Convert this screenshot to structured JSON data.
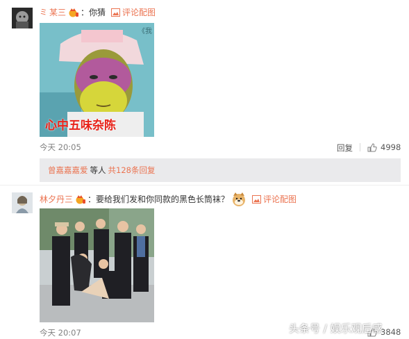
{
  "comment1": {
    "name": "某三",
    "separator": "：",
    "text": "你猜",
    "link": "评论配图",
    "image_caption": "心中五味杂陈",
    "image_corner": "《我",
    "time": "今天 20:05",
    "reply": "回复",
    "likes": "4998",
    "replies": {
      "user": "曾嘉嘉嘉爱",
      "middle": "等人",
      "link": "共128条回复"
    }
  },
  "comment2": {
    "name": "林夕丹三",
    "separator": "：",
    "text": "要给我们发和你同款的黑色长筒袜？",
    "link": "评论配图",
    "time": "今天 20:07",
    "likes": "3848"
  },
  "watermark": "头条号 / 娱乐观后感",
  "colors": {
    "accent": "#eb7350",
    "meta": "#808080",
    "reply_bg": "#eaeaec"
  }
}
